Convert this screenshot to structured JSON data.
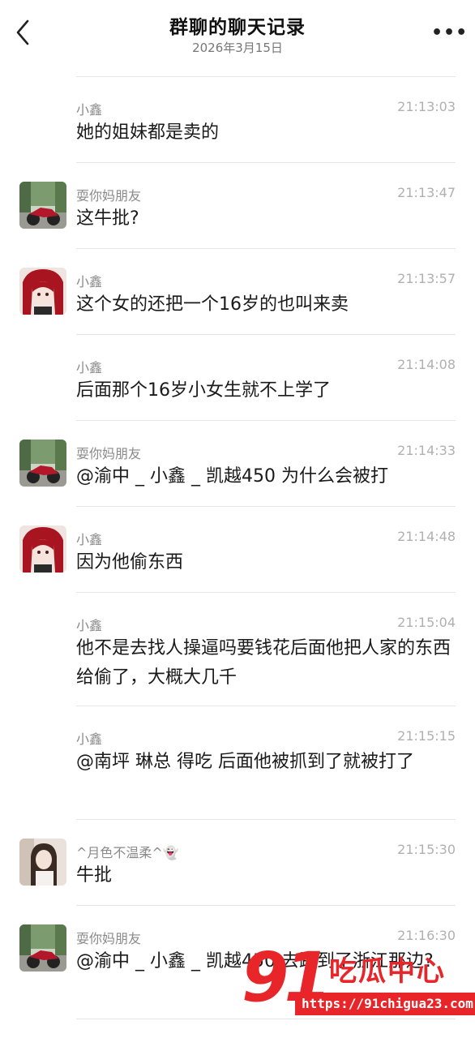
{
  "header": {
    "title": "群聊的聊天记录",
    "date": "2026年3月15日"
  },
  "messages": [
    {
      "sender": "小鑫",
      "time": "21:13:03",
      "text": "她的姐妹都是卖的",
      "avatar": "none"
    },
    {
      "sender": "耍你妈朋友",
      "time": "21:13:47",
      "text": "这牛批?",
      "avatar": "motorcycle"
    },
    {
      "sender": "小鑫",
      "time": "21:13:57",
      "text": "这个女的还把一个16岁的也叫来卖",
      "avatar": "anime-girl"
    },
    {
      "sender": "小鑫",
      "time": "21:14:08",
      "text": "后面那个16岁小女生就不上学了",
      "avatar": "none"
    },
    {
      "sender": "耍你妈朋友",
      "time": "21:14:33",
      "text": "@渝中 _ 小鑫 _ 凯越450 为什么会被打",
      "avatar": "motorcycle"
    },
    {
      "sender": "小鑫",
      "time": "21:14:48",
      "text": "因为他偷东西",
      "avatar": "anime-girl"
    },
    {
      "sender": "小鑫",
      "time": "21:15:04",
      "text": "他不是去找人操逼吗要钱花后面他把人家的东西给偷了，大概大几千",
      "avatar": "none"
    },
    {
      "sender": "小鑫",
      "time": "21:15:15",
      "text": "@南坪  琳总  得吃 后面他被抓到了就被打了",
      "avatar": "none"
    },
    {
      "sender": "^月色不温柔^👻",
      "time": "21:15:30",
      "text": "牛批",
      "avatar": "girl-photo"
    },
    {
      "sender": "耍你妈朋友",
      "time": "21:16:30",
      "text": "@渝中 _ 小鑫 _ 凯越450 去跑到了浙江那边?",
      "avatar": "motorcycle"
    }
  ],
  "watermark": {
    "number": "91",
    "brand": "吃瓜中心",
    "url": "https://91chigua23.com"
  },
  "colors": {
    "accent_red": "#e8262a",
    "time_gray": "#b0b0b0",
    "sender_gray": "#8a8a8a"
  }
}
